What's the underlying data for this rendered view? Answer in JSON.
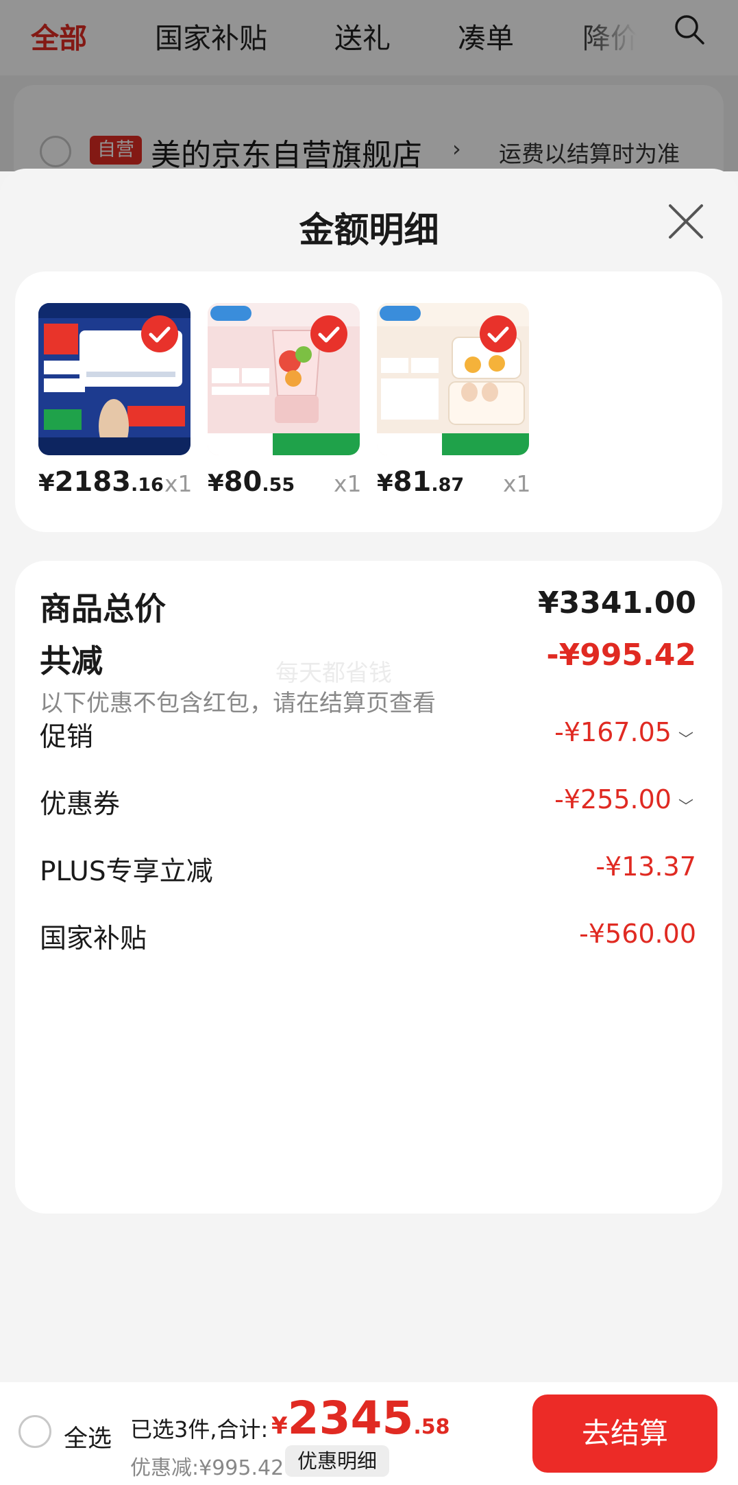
{
  "tabs": [
    "全部",
    "国家补贴",
    "送礼",
    "凑单",
    "降价"
  ],
  "shop": {
    "badge": "自营",
    "name": "美的京东自营旗舰店",
    "shipping_note": "运费以结算时为准"
  },
  "sheet": {
    "title": "金额明细",
    "products": [
      {
        "price_int": "2183",
        "price_dec": ".16",
        "qty": "x1",
        "image": "air-conditioner-product-image"
      },
      {
        "price_int": "80",
        "price_dec": ".55",
        "qty": "x1",
        "image": "blender-product-image"
      },
      {
        "price_int": "81",
        "price_dec": ".87",
        "qty": "x1",
        "image": "egg-steamer-product-image"
      }
    ],
    "currency": "¥",
    "total_label": "商品总价",
    "total_value": "¥3341.00",
    "reduce_label": "共减",
    "reduce_value": "-¥995.42",
    "reduce_hint": "以下优惠不包含红包，请在结算页查看",
    "watermark": "每天都省钱",
    "breakdown": [
      {
        "label": "促销",
        "value": "-¥167.05",
        "expandable": true
      },
      {
        "label": "优惠券",
        "value": "-¥255.00",
        "expandable": true
      },
      {
        "label": "PLUS专享立减",
        "value": "-¥13.37",
        "expandable": false
      },
      {
        "label": "国家补贴",
        "value": "-¥560.00",
        "expandable": false
      }
    ]
  },
  "bottom_bar": {
    "select_all": "全选",
    "selected_summary": "已选3件,合计:",
    "currency": "¥",
    "total_int": "2345",
    "total_dec": ".58",
    "saved": "优惠减:¥995.42",
    "detail_button": "优惠明细",
    "checkout_button": "去结算"
  },
  "colors": {
    "accent": "#e22b24",
    "checkout": "#ec2b27",
    "discount_text": "#e02a22"
  }
}
